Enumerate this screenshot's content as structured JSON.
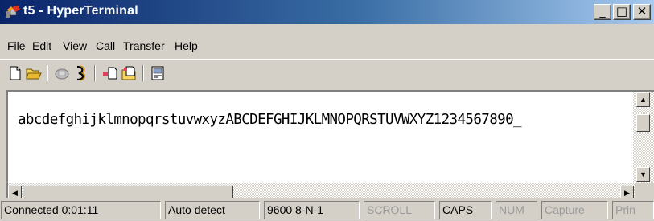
{
  "window": {
    "title": "t5 - HyperTerminal",
    "icon": "hyperterminal-icon",
    "controls": {
      "minimize": "_",
      "maximize": "□",
      "close": "✕"
    }
  },
  "menu": [
    {
      "label": "File"
    },
    {
      "label": "Edit"
    },
    {
      "label": "View"
    },
    {
      "label": "Call"
    },
    {
      "label": "Transfer"
    },
    {
      "label": "Help"
    }
  ],
  "toolbar": [
    {
      "icon": "new-connection-icon"
    },
    {
      "icon": "open-icon"
    },
    {
      "icon": "call-icon"
    },
    {
      "icon": "disconnect-icon"
    },
    {
      "icon": "send-icon"
    },
    {
      "icon": "receive-icon"
    },
    {
      "icon": "properties-icon"
    }
  ],
  "terminal": {
    "text": "abcdefghijklmnopqrstuvwxyzABCDEFGHIJKLMNOPQRSTUVWXYZ1234567890",
    "cursor": "_"
  },
  "statusbar": {
    "connected": "Connected 0:01:11",
    "detect": "Auto detect",
    "settings": "9600 8-N-1",
    "scroll": "SCROLL",
    "caps": "CAPS",
    "num": "NUM",
    "capture": "Capture",
    "print": "Prin"
  }
}
